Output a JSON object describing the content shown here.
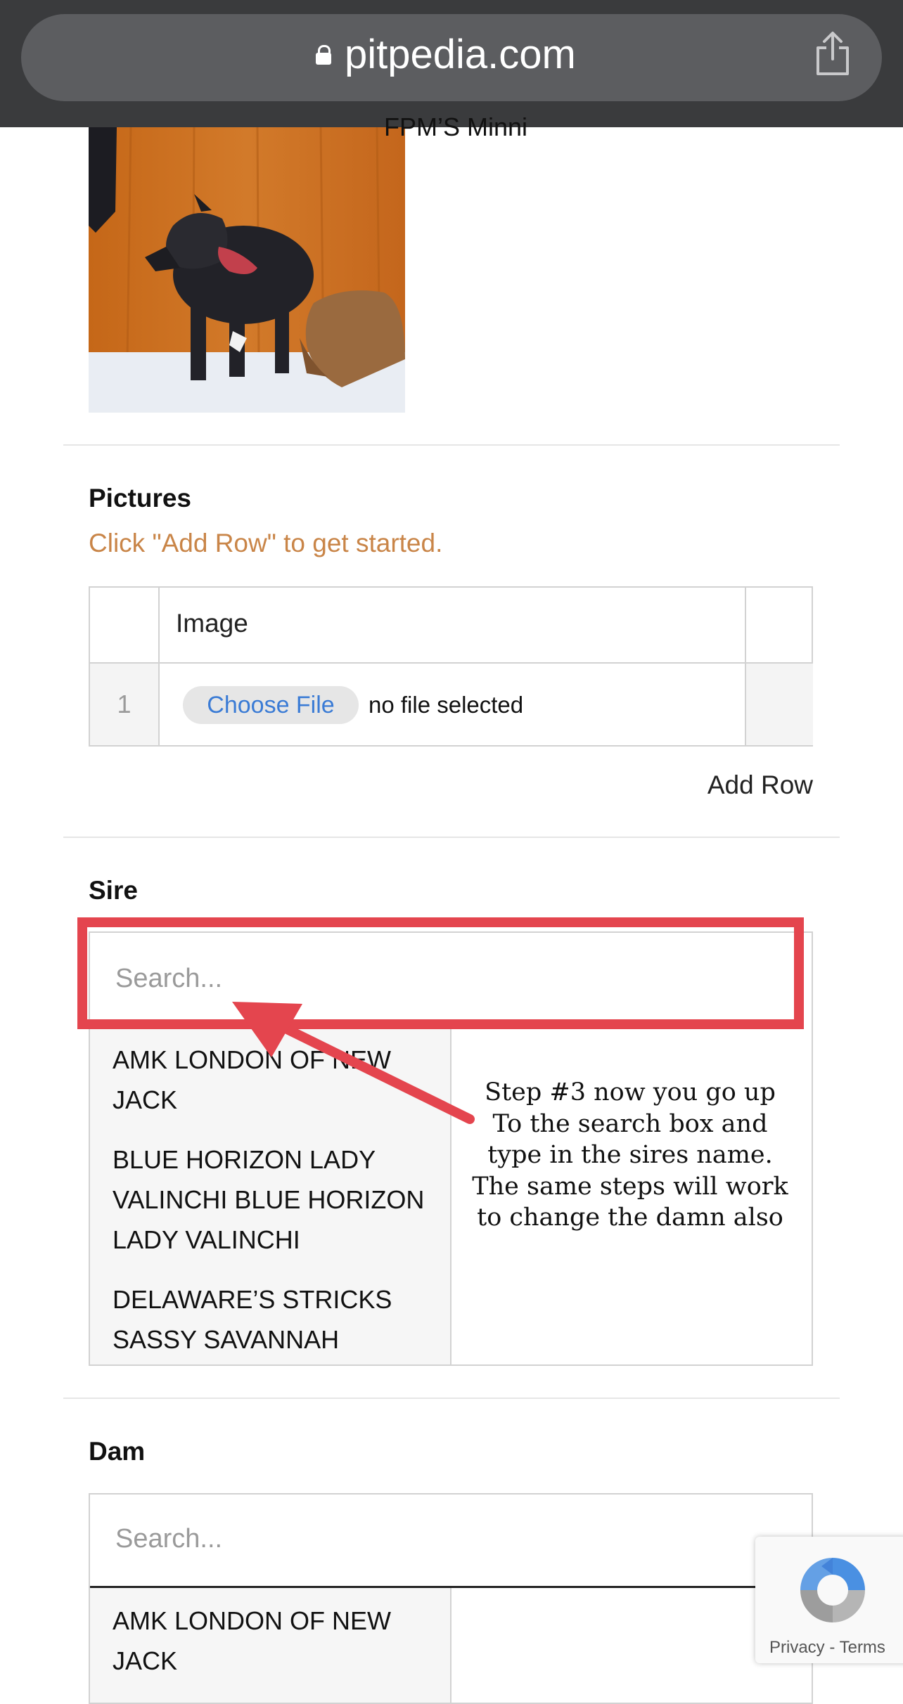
{
  "browser": {
    "url": "pitpedia.com"
  },
  "pictures": {
    "label": "Pictures",
    "hint": "Click \"Add Row\" to get started.",
    "table_header": "Image",
    "row_number": "1",
    "choose_file_label": "Choose File",
    "file_status": "no file selected",
    "add_row_label": "Add Row"
  },
  "sire": {
    "label": "Sire",
    "search_placeholder": "Search...",
    "options": [
      "AMK LONDON OF NEW JACK",
      "BLUE HORIZON LADY VALINCHI BLUE HORIZON LADY VALINCHI",
      "DELAWARE’S STRICKS SASSY SAVANNAH"
    ],
    "annotation": "Step #3 now you go up To the search box and type in the sires name. The same steps will work to change the damn also"
  },
  "dam": {
    "label": "Dam",
    "search_placeholder": "Search...",
    "options": [
      "AMK LONDON OF NEW JACK"
    ],
    "selected": [
      "FPM’S Minni"
    ]
  },
  "recaptcha": {
    "privacy_label": "Privacy",
    "separator": " - ",
    "terms_label": "Terms"
  },
  "colors": {
    "annotation_red": "#e4454e",
    "hint_orange": "#c98548",
    "link_blue": "#3a7bd5"
  }
}
